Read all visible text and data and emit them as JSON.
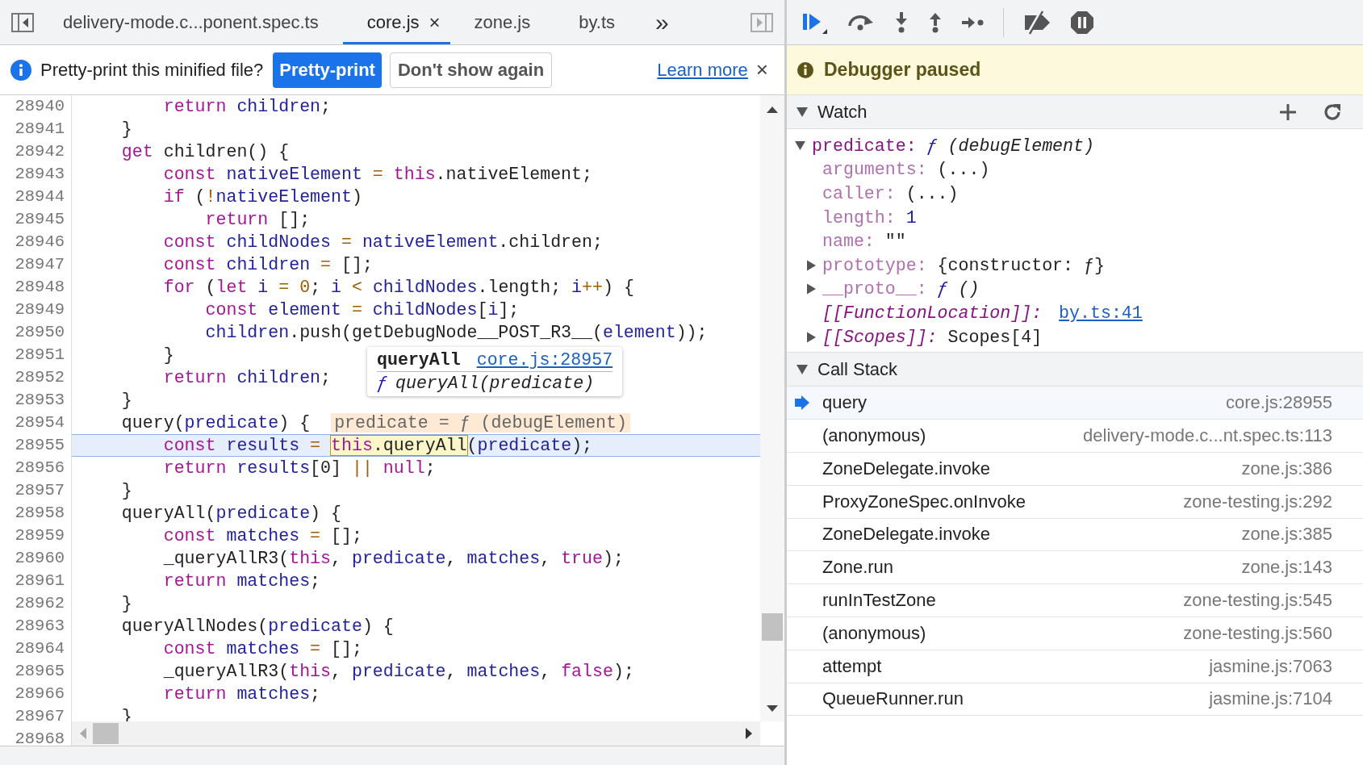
{
  "tabs": [
    {
      "label": "delivery-mode.c...ponent.spec.ts",
      "selected": false
    },
    {
      "label": "core.js",
      "selected": true,
      "close": "×"
    },
    {
      "label": "zone.js",
      "selected": false
    },
    {
      "label": "by.ts",
      "selected": false
    }
  ],
  "tabs_overflow": "»",
  "banner": {
    "message": "Pretty-print this minified file?",
    "primary": "Pretty-print",
    "secondary": "Don't show again",
    "link": "Learn more",
    "close": "×"
  },
  "code": {
    "lines": [
      {
        "number": "28940",
        "current": false,
        "tokens": [
          {
            "kw": "        return"
          },
          {
            "id": " children"
          },
          {
            "p": ";"
          }
        ]
      },
      {
        "number": "28941",
        "current": false,
        "tokens": [
          {
            "p": "    }"
          }
        ]
      },
      {
        "number": "28942",
        "current": false,
        "tokens": [
          {
            "kw": "    get"
          },
          {
            "p": " children() {"
          }
        ]
      },
      {
        "number": "28943",
        "current": false,
        "tokens": [
          {
            "kw": "        const"
          },
          {
            "id": " nativeElement"
          },
          {
            "op": " ="
          },
          {
            "kw": " this"
          },
          {
            "p": ".nativeElement;"
          }
        ]
      },
      {
        "number": "28944",
        "current": false,
        "tokens": [
          {
            "kw": "        if"
          },
          {
            "p": " ("
          },
          {
            "op": "!"
          },
          {
            "id": "nativeElement"
          },
          {
            "p": ")"
          }
        ]
      },
      {
        "number": "28945",
        "current": false,
        "tokens": [
          {
            "kw": "            return"
          },
          {
            "p": " [];"
          }
        ]
      },
      {
        "number": "28946",
        "current": false,
        "tokens": [
          {
            "kw": "        const"
          },
          {
            "id": " childNodes"
          },
          {
            "op": " ="
          },
          {
            "id": " nativeElement"
          },
          {
            "p": ".children;"
          }
        ]
      },
      {
        "number": "28947",
        "current": false,
        "tokens": [
          {
            "kw": "        const"
          },
          {
            "id": " children"
          },
          {
            "op": " ="
          },
          {
            "p": " [];"
          }
        ]
      },
      {
        "number": "28948",
        "current": false,
        "tokens": [
          {
            "kw": "        for"
          },
          {
            "p": " ("
          },
          {
            "kw": "let"
          },
          {
            "id": " i"
          },
          {
            "op": " = 0"
          },
          {
            "p": ";"
          },
          {
            "id": " i"
          },
          {
            "op": " <"
          },
          {
            "id": " childNodes"
          },
          {
            "p": ".length;"
          },
          {
            "id": " i"
          },
          {
            "op": "++"
          },
          {
            "p": ") {"
          }
        ]
      },
      {
        "number": "28949",
        "current": false,
        "tokens": [
          {
            "kw": "            const"
          },
          {
            "id": " element"
          },
          {
            "op": " ="
          },
          {
            "id": " childNodes"
          },
          {
            "p": "["
          },
          {
            "id": "i"
          },
          {
            "p": "];"
          }
        ]
      },
      {
        "number": "28950",
        "current": false,
        "tokens": [
          {
            "id": "            children"
          },
          {
            "p": ".push(getDebugNode__POST_R3__("
          },
          {
            "id": "element"
          },
          {
            "p": "));"
          }
        ]
      },
      {
        "number": "28951",
        "current": false,
        "tokens": [
          {
            "p": "        }"
          }
        ]
      },
      {
        "number": "28952",
        "current": false,
        "tokens": [
          {
            "kw": "        return"
          },
          {
            "id": " children"
          },
          {
            "p": ";"
          }
        ]
      },
      {
        "number": "28953",
        "current": false,
        "tokens": [
          {
            "p": "    }"
          }
        ]
      },
      {
        "number": "28954",
        "current": false,
        "tokens": [
          {
            "p": "    query("
          },
          {
            "id": "predicate"
          },
          {
            "p": ") {"
          }
        ],
        "inline_value": "predicate = ƒ (debugElement)"
      },
      {
        "number": "28955",
        "current": true,
        "tokens": [
          {
            "kw": "        const"
          },
          {
            "id": " results"
          },
          {
            "op": " = "
          },
          {
            "hover": [
              {
                "kw": "this"
              },
              {
                "p": ".queryAll"
              }
            ]
          },
          {
            "p": "("
          },
          {
            "id": "predicate"
          },
          {
            "p": ");"
          }
        ]
      },
      {
        "number": "28956",
        "current": false,
        "tokens": [
          {
            "kw": "        return"
          },
          {
            "id": " results"
          },
          {
            "p": "[0] "
          },
          {
            "op": "||"
          },
          {
            "kw": " null"
          },
          {
            "p": ";"
          }
        ]
      },
      {
        "number": "28957",
        "current": false,
        "tokens": [
          {
            "p": "    }"
          }
        ]
      },
      {
        "number": "28958",
        "current": false,
        "tokens": [
          {
            "p": "    queryAll("
          },
          {
            "id": "predicate"
          },
          {
            "p": ") {"
          }
        ]
      },
      {
        "number": "28959",
        "current": false,
        "tokens": [
          {
            "kw": "        const"
          },
          {
            "id": " matches"
          },
          {
            "op": " ="
          },
          {
            "p": " [];"
          }
        ]
      },
      {
        "number": "28960",
        "current": false,
        "tokens": [
          {
            "p": "        _queryAllR3("
          },
          {
            "kw": "this"
          },
          {
            "p": ", "
          },
          {
            "id": "predicate"
          },
          {
            "p": ", "
          },
          {
            "id": "matches"
          },
          {
            "p": ", "
          },
          {
            "kw": "true"
          },
          {
            "p": ");"
          }
        ]
      },
      {
        "number": "28961",
        "current": false,
        "tokens": [
          {
            "kw": "        return"
          },
          {
            "id": " matches"
          },
          {
            "p": ";"
          }
        ]
      },
      {
        "number": "28962",
        "current": false,
        "tokens": [
          {
            "p": "    }"
          }
        ]
      },
      {
        "number": "28963",
        "current": false,
        "tokens": [
          {
            "p": "    queryAllNodes("
          },
          {
            "id": "predicate"
          },
          {
            "p": ") {"
          }
        ]
      },
      {
        "number": "28964",
        "current": false,
        "tokens": [
          {
            "kw": "        const"
          },
          {
            "id": " matches"
          },
          {
            "op": " ="
          },
          {
            "p": " [];"
          }
        ]
      },
      {
        "number": "28965",
        "current": false,
        "tokens": [
          {
            "p": "        _queryAllR3("
          },
          {
            "kw": "this"
          },
          {
            "p": ", "
          },
          {
            "id": "predicate"
          },
          {
            "p": ", "
          },
          {
            "id": "matches"
          },
          {
            "p": ", "
          },
          {
            "kw": "false"
          },
          {
            "p": ");"
          }
        ]
      },
      {
        "number": "28966",
        "current": false,
        "tokens": [
          {
            "kw": "        return"
          },
          {
            "id": " matches"
          },
          {
            "p": ";"
          }
        ]
      },
      {
        "number": "28967",
        "current": false,
        "tokens": [
          {
            "p": "    }"
          }
        ]
      },
      {
        "number": "28968"
      }
    ]
  },
  "tooltip": {
    "title": "queryAll",
    "location": "core.js:28957",
    "symbol": "ƒ",
    "signature": "queryAll(predicate)"
  },
  "debugger_status": "Debugger paused",
  "watch": {
    "title": "Watch",
    "expanded": true,
    "item": {
      "key": "predicate:",
      "symbol": "ƒ",
      "value": "(debugElement)",
      "expanded": true,
      "children": [
        {
          "prop": "arguments:",
          "value": "(...)"
        },
        {
          "prop": "caller:",
          "value": "(...)"
        },
        {
          "prop": "length:",
          "number": "1"
        },
        {
          "prop": "name:",
          "value": "\"\""
        },
        {
          "prop": "prototype:",
          "value": "{constructor: ƒ}",
          "expanded": false
        },
        {
          "prop": "__proto__:",
          "symbol": "ƒ",
          "function": "()",
          "expanded": false
        },
        {
          "internal": "[[FunctionLocation]]:",
          "link": "by.ts:41"
        },
        {
          "internal": "[[Scopes]]:",
          "value": "Scopes[4]",
          "expanded": false
        }
      ]
    }
  },
  "call_stack": {
    "title": "Call Stack",
    "expanded": true,
    "frames": [
      {
        "name": "query",
        "location": "core.js:28955",
        "selected": true
      },
      {
        "name": "(anonymous)",
        "location": "delivery-mode.c...nt.spec.ts:113",
        "selected": false
      },
      {
        "name": "ZoneDelegate.invoke",
        "location": "zone.js:386",
        "selected": false
      },
      {
        "name": "ProxyZoneSpec.onInvoke",
        "location": "zone-testing.js:292",
        "selected": false
      },
      {
        "name": "ZoneDelegate.invoke",
        "location": "zone.js:385",
        "selected": false
      },
      {
        "name": "Zone.run",
        "location": "zone.js:143",
        "selected": false
      },
      {
        "name": "runInTestZone",
        "location": "zone-testing.js:545",
        "selected": false
      },
      {
        "name": "(anonymous)",
        "location": "zone-testing.js:560",
        "selected": false
      },
      {
        "name": "attempt",
        "location": "jasmine.js:7063",
        "selected": false
      },
      {
        "name": "QueueRunner.run",
        "location": "jasmine.js:7104",
        "selected": false
      }
    ]
  }
}
